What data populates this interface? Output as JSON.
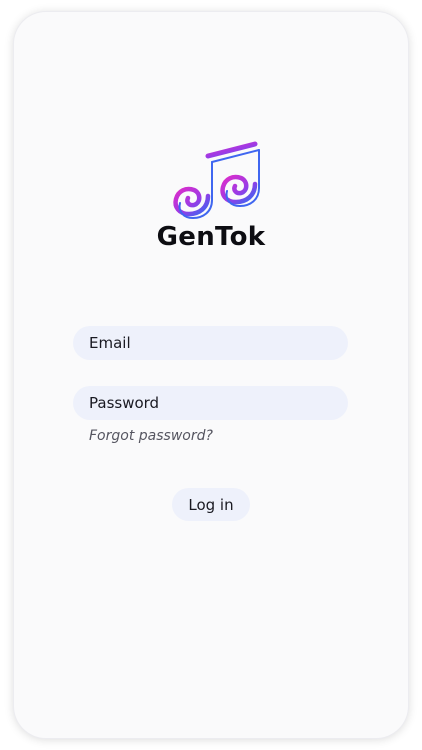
{
  "app": {
    "name": "GenTok",
    "logo_icon": "music-note-icon",
    "logo_colors": [
      "#d02bd3",
      "#3f66f0"
    ]
  },
  "form": {
    "email_placeholder": "Email",
    "password_placeholder": "Password",
    "forgot_label": "Forgot password?",
    "login_label": "Log in"
  },
  "colors": {
    "field_bg": "#eef1fb",
    "card_bg": "#fafafb",
    "text": "#1a1a22"
  }
}
